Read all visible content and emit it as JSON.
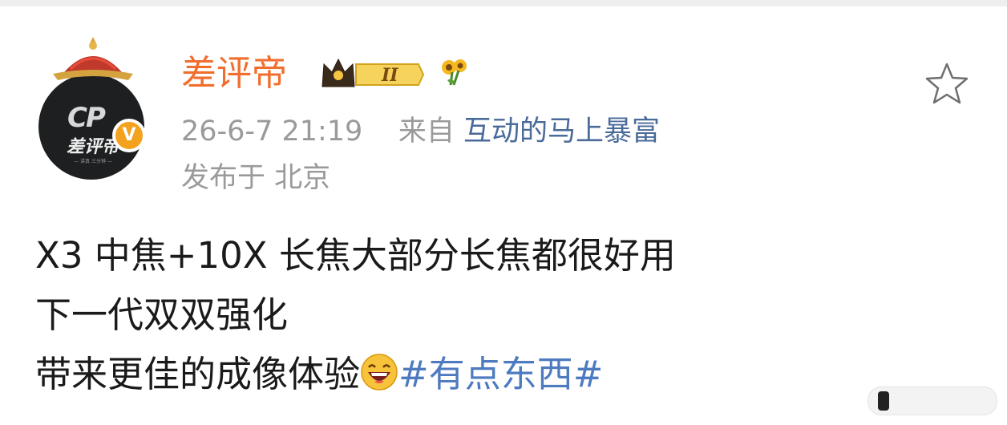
{
  "user": {
    "name": "差评帝",
    "verified_mark": "V",
    "level_badge": "II",
    "avatar_logo": "CP",
    "avatar_name": "差评帝",
    "avatar_sub": "— 讲真 三分钟 —"
  },
  "meta": {
    "time": "26-6-7 21:19",
    "from_label": "来自",
    "source": "互动的马上暴富",
    "location": "发布于 北京"
  },
  "post": {
    "line1": "X3 中焦+10X 长焦大部分长焦都很好用",
    "line2": "下一代双双强化",
    "line3_text": "带来更佳的成像体验",
    "hashtag": "#有点东西#"
  },
  "icons": {
    "favorite": "star-outline-icon",
    "flower": "sunflower-icon",
    "emoji": "laughing-emoji-icon",
    "crown": "crown-icon"
  },
  "colors": {
    "username": "#f16e2e",
    "link": "#4a6a9a",
    "hashtag": "#4e7bc0",
    "meta": "#9a9a9a",
    "verified": "#f4a21d"
  }
}
